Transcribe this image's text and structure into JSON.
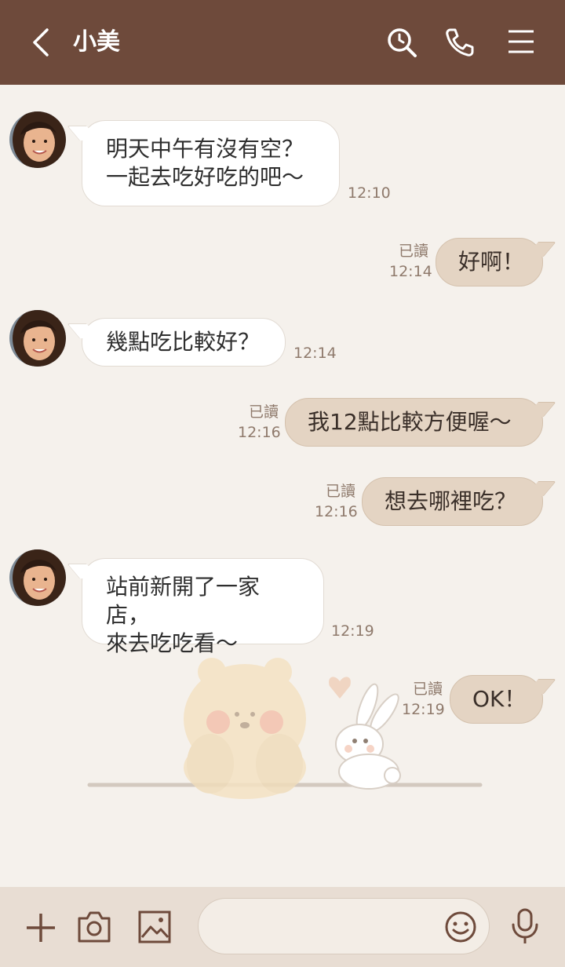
{
  "header": {
    "title": "小美",
    "back_icon": "chevron-left-icon",
    "search_icon": "search-icon",
    "call_icon": "phone-icon",
    "menu_icon": "menu-icon"
  },
  "messages": [
    {
      "side": "in",
      "text": "明天中午有沒有空？\n一起去吃好吃的吧～",
      "time": "12:10"
    },
    {
      "side": "out",
      "text": "好啊！",
      "read": "已讀",
      "time": "12:14"
    },
    {
      "side": "in",
      "text": "幾點吃比較好？",
      "time": "12:14"
    },
    {
      "side": "out",
      "text": "我12點比較方便喔～",
      "read": "已讀",
      "time": "12:16"
    },
    {
      "side": "out",
      "text": "想去哪裡吃？",
      "read": "已讀",
      "time": "12:16"
    },
    {
      "side": "in",
      "text": "站前新開了一家店，\n來去吃吃看～",
      "time": "12:19"
    },
    {
      "side": "out",
      "text": "OK！",
      "read": "已讀",
      "time": "12:19"
    }
  ],
  "footer": {
    "plus_icon": "plus-icon",
    "camera_icon": "camera-icon",
    "image_icon": "image-icon",
    "input_value": "",
    "emoji_icon": "emoji-icon",
    "mic_icon": "microphone-icon"
  },
  "colors": {
    "header_bg": "#6e4a3b",
    "chat_bg": "#f5f1ec",
    "outgoing_bubble": "#e4d4c3",
    "incoming_bubble": "#ffffff",
    "footer_bg": "#e8ddd3"
  }
}
